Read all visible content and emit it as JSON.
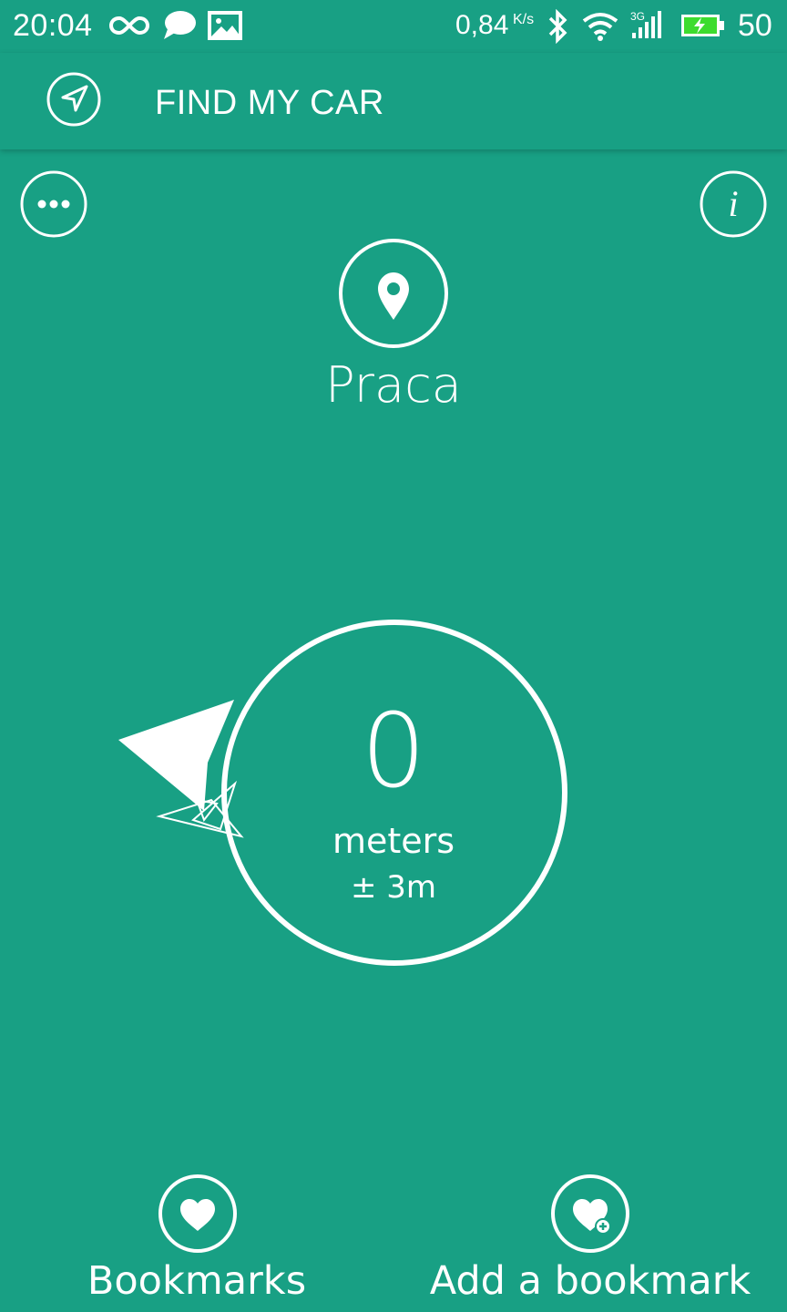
{
  "status_bar": {
    "time": "20:04",
    "network_speed": "0,84",
    "network_speed_unit": "K/s",
    "battery_level": "50",
    "icons": [
      "infinity-icon",
      "chat-bubble-icon",
      "image-icon",
      "bluetooth-icon",
      "wifi-icon",
      "signal-3g-icon",
      "battery-charging-icon"
    ]
  },
  "app_bar": {
    "title": "FIND MY CAR",
    "nav_icon": "navigation-arrow-icon"
  },
  "top_actions": {
    "menu_icon": "more-options-icon",
    "info_icon": "info-icon"
  },
  "destination": {
    "icon": "map-pin-icon",
    "name": "Praca"
  },
  "distance": {
    "value": "0",
    "unit": "meters",
    "accuracy": "± 3m"
  },
  "bottom_actions": {
    "bookmarks_label": "Bookmarks",
    "add_bookmark_label": "Add a bookmark"
  },
  "colors": {
    "background": "#18a084",
    "foreground": "#ffffff",
    "battery_fill": "#3ddc2f"
  }
}
